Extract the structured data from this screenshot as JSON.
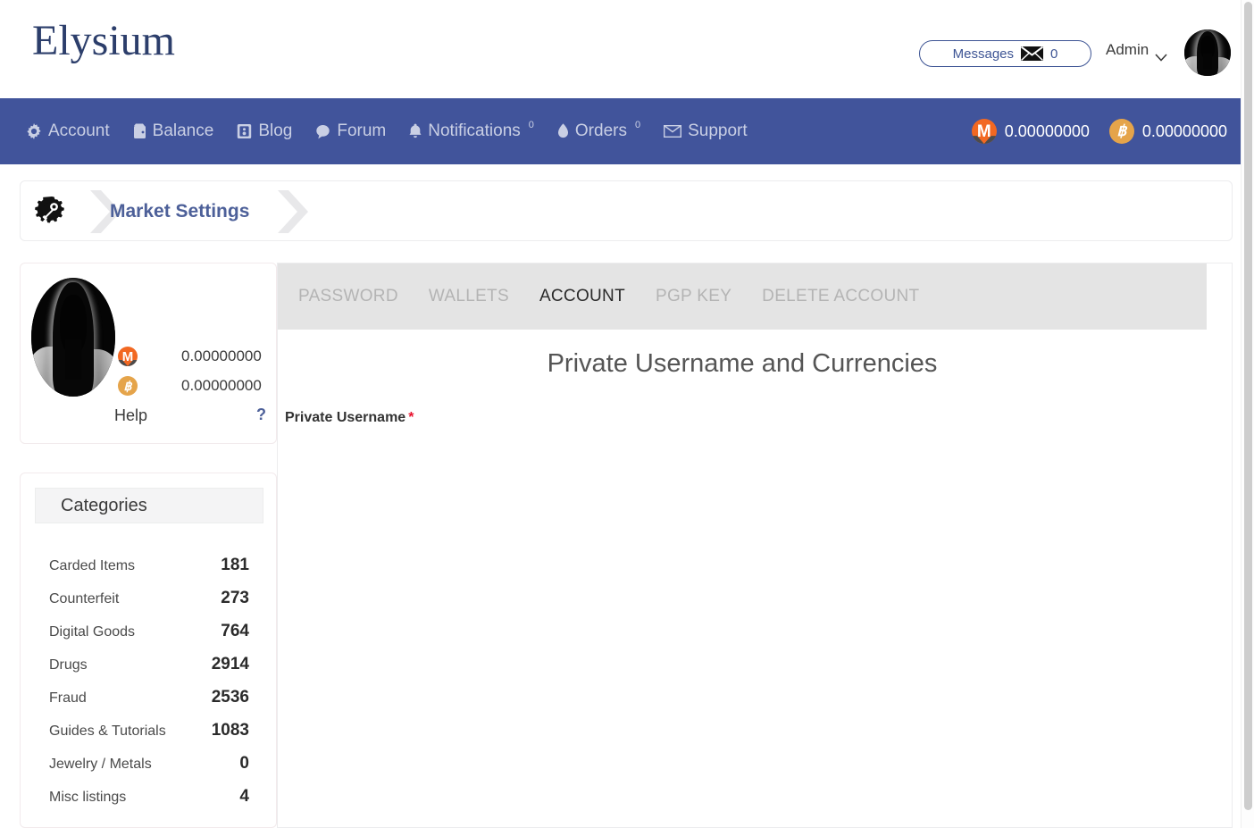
{
  "header": {
    "logo": "Elysium",
    "messages_label": "Messages",
    "messages_count": "0",
    "messages_icon": "envelope-icon",
    "user_name": "Admin",
    "user_chevron_icon": "chevron-down-icon",
    "avatar_icon": "user-avatar"
  },
  "nav": {
    "background": "#41549b",
    "items": [
      {
        "label": "Account",
        "icon": "gear-icon",
        "badge": ""
      },
      {
        "label": "Balance",
        "icon": "wallet-icon",
        "badge": ""
      },
      {
        "label": "Blog",
        "icon": "book-icon",
        "badge": ""
      },
      {
        "label": "Forum",
        "icon": "chat-bubble-icon",
        "badge": ""
      },
      {
        "label": "Notifications",
        "icon": "bell-icon",
        "badge": "0"
      },
      {
        "label": "Orders",
        "icon": "flame-icon",
        "badge": "0"
      },
      {
        "label": "Support",
        "icon": "envelope-icon",
        "badge": ""
      }
    ],
    "balances": [
      {
        "currency": "XMR",
        "icon": "monero-icon",
        "value": "0.00000000",
        "color": "#f26822"
      },
      {
        "currency": "BTC",
        "icon": "bitcoin-icon",
        "value": "0.00000000",
        "color": "#e5a44a"
      }
    ]
  },
  "breadcrumb": {
    "icon": "settings-wrench-gear-icon",
    "title": "Market Settings",
    "separator_icon": "chevron-right-icon"
  },
  "profile": {
    "avatar_icon": "user-avatar-large",
    "balances": [
      {
        "currency": "XMR",
        "icon": "monero-icon",
        "value": "0.00000000"
      },
      {
        "currency": "BTC",
        "icon": "bitcoin-icon",
        "value": "0.00000000"
      }
    ],
    "help_label": "Help",
    "help_link": "?"
  },
  "categories": {
    "title": "Categories",
    "items": [
      {
        "name": "Carded Items",
        "count": "181"
      },
      {
        "name": "Counterfeit",
        "count": "273"
      },
      {
        "name": "Digital Goods",
        "count": "764"
      },
      {
        "name": "Drugs",
        "count": "2914"
      },
      {
        "name": "Fraud",
        "count": "2536"
      },
      {
        "name": "Guides & Tutorials",
        "count": "1083"
      },
      {
        "name": "Jewelry / Metals",
        "count": "0"
      },
      {
        "name": "Misc listings",
        "count": "4"
      }
    ]
  },
  "main": {
    "tabs": [
      {
        "label": "PASSWORD",
        "active": false
      },
      {
        "label": "WALLETS",
        "active": false
      },
      {
        "label": "ACCOUNT",
        "active": true
      },
      {
        "label": "PGP KEY",
        "active": false
      },
      {
        "label": "DELETE ACCOUNT",
        "active": false
      }
    ],
    "title": "Private Username and Currencies",
    "field_label": "Private Username",
    "required_marker": "*"
  }
}
